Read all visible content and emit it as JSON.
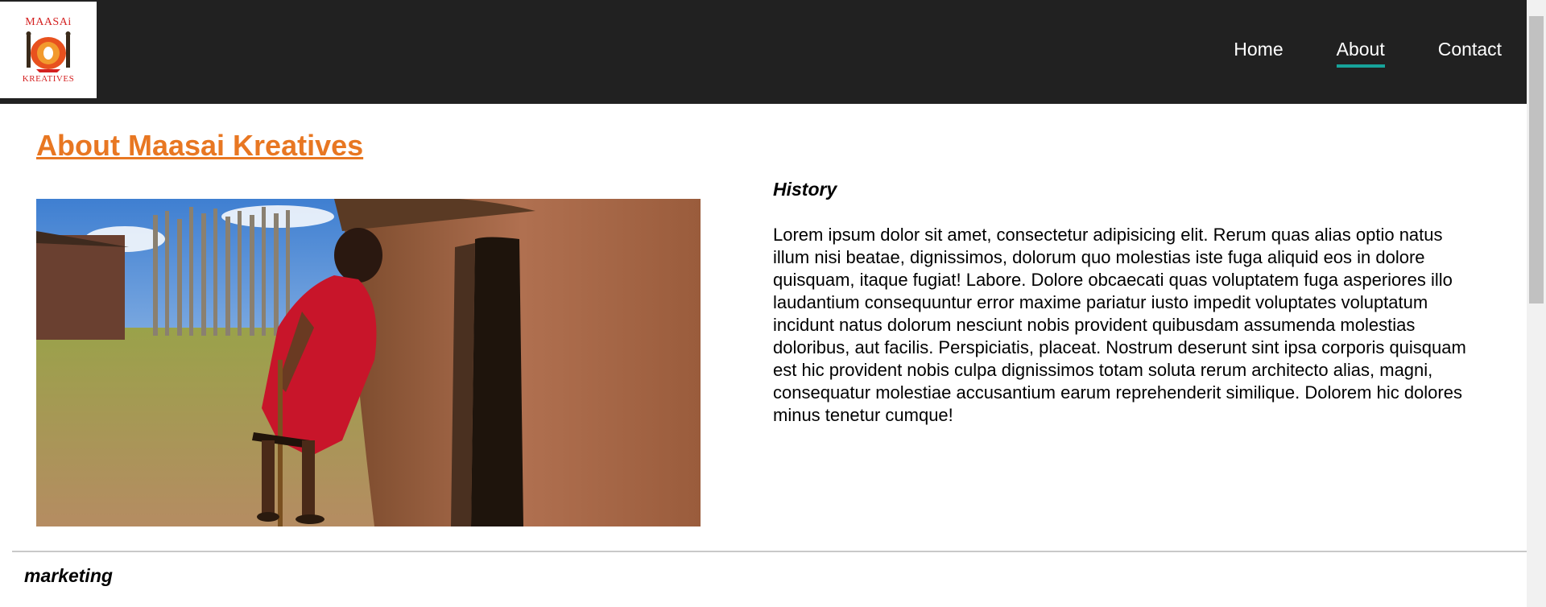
{
  "header": {
    "logo": {
      "top_text": "MAASAi",
      "bottom_text": "KREATIVES",
      "icon": "maasai-shields-logo"
    },
    "nav": [
      {
        "label": "Home",
        "active": false
      },
      {
        "label": "About",
        "active": true
      },
      {
        "label": "Contact",
        "active": false
      }
    ],
    "colors": {
      "bar": "#212121",
      "active_underline": "#17a39a"
    }
  },
  "main": {
    "title": "About Maasai Kreatives",
    "title_color": "#e87722",
    "history_heading": "History",
    "history_text": "Lorem ipsum dolor sit amet, consectetur adipisicing elit. Rerum quas alias optio natus illum nisi beatae, dignissimos, dolorum quo molestias iste fuga aliquid eos in dolore quisquam, itaque fugiat! Labore. Dolore obcaecati quas voluptatem fuga asperiores illo laudantium consequuntur error maxime pariatur iusto impedit voluptates voluptatum incidunt natus dolorum nesciunt nobis provident quibusdam assumenda molestias doloribus, aut facilis. Perspiciatis, placeat. Nostrum deserunt sint ipsa corporis quisquam est hic provident nobis culpa dignissimos totam soluta rerum architecto alias, magni, consequatur molestiae accusantium earum reprehenderit similique. Dolorem hic dolores minus tenetur cumque!",
    "marketing_heading": "marketing"
  }
}
